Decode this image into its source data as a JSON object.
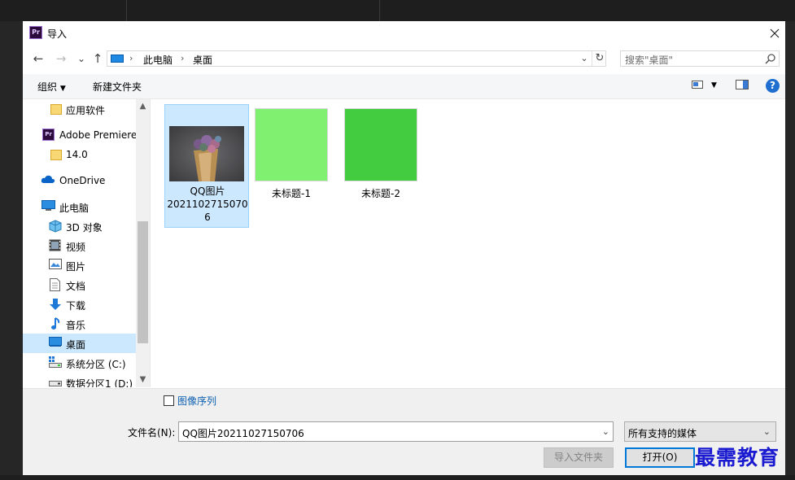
{
  "window": {
    "title": "导入",
    "app_logo_text": "Pr"
  },
  "nav": {
    "back": "←",
    "forward": "→",
    "recent": "⌄",
    "up": "↑",
    "breadcrumb": [
      "此电脑",
      "桌面"
    ],
    "search_placeholder": "搜索\"桌面\""
  },
  "toolbar": {
    "organize_label": "组织",
    "new_folder_label": "新建文件夹",
    "help": "?"
  },
  "sidebar": {
    "items": [
      {
        "label": "应用软件",
        "icon": "folder-icon",
        "selected": false
      },
      {
        "label": "Adobe Premiere",
        "icon": "premiere-icon",
        "selected": false
      },
      {
        "label": "14.0",
        "icon": "folder-icon",
        "selected": false
      },
      {
        "label": "OneDrive",
        "icon": "onedrive-icon",
        "selected": false
      },
      {
        "label": "此电脑",
        "icon": "pc-icon",
        "selected": false
      },
      {
        "label": "3D 对象",
        "icon": "3d-objects-icon",
        "selected": false
      },
      {
        "label": "视频",
        "icon": "video-icon",
        "selected": false
      },
      {
        "label": "图片",
        "icon": "pictures-icon",
        "selected": false
      },
      {
        "label": "文档",
        "icon": "documents-icon",
        "selected": false
      },
      {
        "label": "下载",
        "icon": "download-icon",
        "selected": false
      },
      {
        "label": "音乐",
        "icon": "music-icon",
        "selected": false
      },
      {
        "label": "桌面",
        "icon": "desktop-icon",
        "selected": true
      },
      {
        "label": "系统分区 (C:)",
        "icon": "drive-c-icon",
        "selected": false
      },
      {
        "label": "数据分区1 (D:)",
        "icon": "drive-d-icon",
        "selected": false
      }
    ]
  },
  "files": [
    {
      "name_lines": [
        "QQ图片",
        "2021102715070",
        "6"
      ],
      "type": "photo",
      "selected": true
    },
    {
      "name_lines": [
        "未标题-1"
      ],
      "type": "color",
      "color": "#80f070",
      "selected": false
    },
    {
      "name_lines": [
        "未标题-2"
      ],
      "type": "color",
      "color": "#44cc40",
      "selected": false
    }
  ],
  "bottom": {
    "image_sequence_label": "图像序列",
    "filename_label": "文件名(N):",
    "filename_value": "QQ图片20211027150706",
    "filetype_value": "所有支持的媒体",
    "import_folder_label": "导入文件夹",
    "open_label": "打开(O)"
  },
  "watermark": "最需教育"
}
